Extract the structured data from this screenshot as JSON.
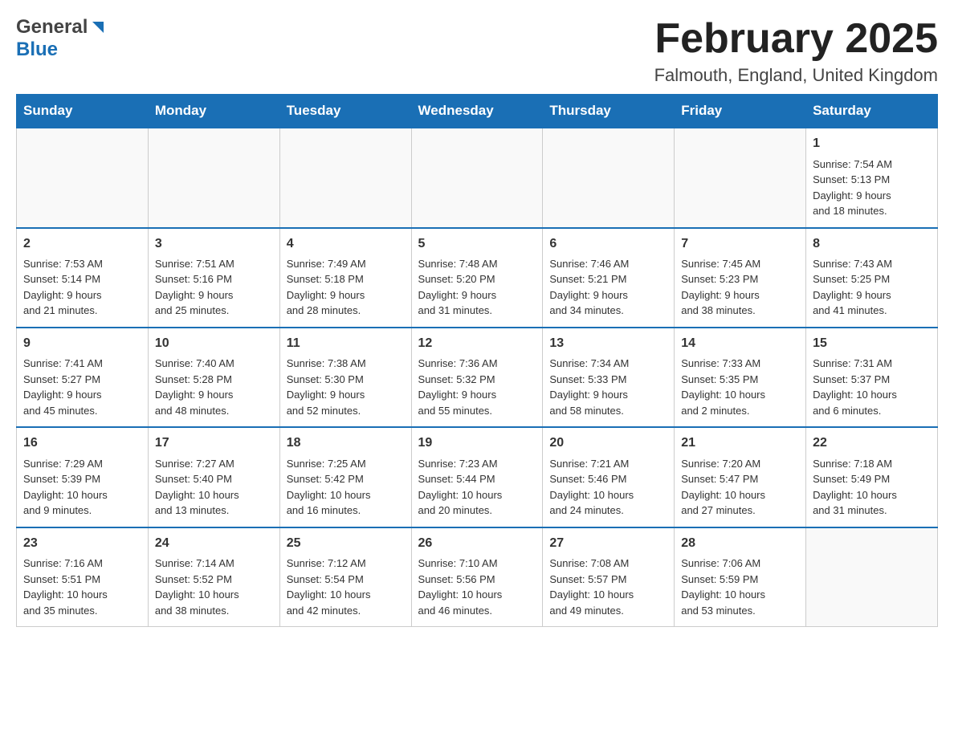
{
  "header": {
    "logo_general": "General",
    "logo_blue": "Blue",
    "title": "February 2025",
    "location": "Falmouth, England, United Kingdom"
  },
  "weekdays": [
    "Sunday",
    "Monday",
    "Tuesday",
    "Wednesday",
    "Thursday",
    "Friday",
    "Saturday"
  ],
  "weeks": [
    [
      {
        "day": "",
        "info": ""
      },
      {
        "day": "",
        "info": ""
      },
      {
        "day": "",
        "info": ""
      },
      {
        "day": "",
        "info": ""
      },
      {
        "day": "",
        "info": ""
      },
      {
        "day": "",
        "info": ""
      },
      {
        "day": "1",
        "info": "Sunrise: 7:54 AM\nSunset: 5:13 PM\nDaylight: 9 hours\nand 18 minutes."
      }
    ],
    [
      {
        "day": "2",
        "info": "Sunrise: 7:53 AM\nSunset: 5:14 PM\nDaylight: 9 hours\nand 21 minutes."
      },
      {
        "day": "3",
        "info": "Sunrise: 7:51 AM\nSunset: 5:16 PM\nDaylight: 9 hours\nand 25 minutes."
      },
      {
        "day": "4",
        "info": "Sunrise: 7:49 AM\nSunset: 5:18 PM\nDaylight: 9 hours\nand 28 minutes."
      },
      {
        "day": "5",
        "info": "Sunrise: 7:48 AM\nSunset: 5:20 PM\nDaylight: 9 hours\nand 31 minutes."
      },
      {
        "day": "6",
        "info": "Sunrise: 7:46 AM\nSunset: 5:21 PM\nDaylight: 9 hours\nand 34 minutes."
      },
      {
        "day": "7",
        "info": "Sunrise: 7:45 AM\nSunset: 5:23 PM\nDaylight: 9 hours\nand 38 minutes."
      },
      {
        "day": "8",
        "info": "Sunrise: 7:43 AM\nSunset: 5:25 PM\nDaylight: 9 hours\nand 41 minutes."
      }
    ],
    [
      {
        "day": "9",
        "info": "Sunrise: 7:41 AM\nSunset: 5:27 PM\nDaylight: 9 hours\nand 45 minutes."
      },
      {
        "day": "10",
        "info": "Sunrise: 7:40 AM\nSunset: 5:28 PM\nDaylight: 9 hours\nand 48 minutes."
      },
      {
        "day": "11",
        "info": "Sunrise: 7:38 AM\nSunset: 5:30 PM\nDaylight: 9 hours\nand 52 minutes."
      },
      {
        "day": "12",
        "info": "Sunrise: 7:36 AM\nSunset: 5:32 PM\nDaylight: 9 hours\nand 55 minutes."
      },
      {
        "day": "13",
        "info": "Sunrise: 7:34 AM\nSunset: 5:33 PM\nDaylight: 9 hours\nand 58 minutes."
      },
      {
        "day": "14",
        "info": "Sunrise: 7:33 AM\nSunset: 5:35 PM\nDaylight: 10 hours\nand 2 minutes."
      },
      {
        "day": "15",
        "info": "Sunrise: 7:31 AM\nSunset: 5:37 PM\nDaylight: 10 hours\nand 6 minutes."
      }
    ],
    [
      {
        "day": "16",
        "info": "Sunrise: 7:29 AM\nSunset: 5:39 PM\nDaylight: 10 hours\nand 9 minutes."
      },
      {
        "day": "17",
        "info": "Sunrise: 7:27 AM\nSunset: 5:40 PM\nDaylight: 10 hours\nand 13 minutes."
      },
      {
        "day": "18",
        "info": "Sunrise: 7:25 AM\nSunset: 5:42 PM\nDaylight: 10 hours\nand 16 minutes."
      },
      {
        "day": "19",
        "info": "Sunrise: 7:23 AM\nSunset: 5:44 PM\nDaylight: 10 hours\nand 20 minutes."
      },
      {
        "day": "20",
        "info": "Sunrise: 7:21 AM\nSunset: 5:46 PM\nDaylight: 10 hours\nand 24 minutes."
      },
      {
        "day": "21",
        "info": "Sunrise: 7:20 AM\nSunset: 5:47 PM\nDaylight: 10 hours\nand 27 minutes."
      },
      {
        "day": "22",
        "info": "Sunrise: 7:18 AM\nSunset: 5:49 PM\nDaylight: 10 hours\nand 31 minutes."
      }
    ],
    [
      {
        "day": "23",
        "info": "Sunrise: 7:16 AM\nSunset: 5:51 PM\nDaylight: 10 hours\nand 35 minutes."
      },
      {
        "day": "24",
        "info": "Sunrise: 7:14 AM\nSunset: 5:52 PM\nDaylight: 10 hours\nand 38 minutes."
      },
      {
        "day": "25",
        "info": "Sunrise: 7:12 AM\nSunset: 5:54 PM\nDaylight: 10 hours\nand 42 minutes."
      },
      {
        "day": "26",
        "info": "Sunrise: 7:10 AM\nSunset: 5:56 PM\nDaylight: 10 hours\nand 46 minutes."
      },
      {
        "day": "27",
        "info": "Sunrise: 7:08 AM\nSunset: 5:57 PM\nDaylight: 10 hours\nand 49 minutes."
      },
      {
        "day": "28",
        "info": "Sunrise: 7:06 AM\nSunset: 5:59 PM\nDaylight: 10 hours\nand 53 minutes."
      },
      {
        "day": "",
        "info": ""
      }
    ]
  ]
}
